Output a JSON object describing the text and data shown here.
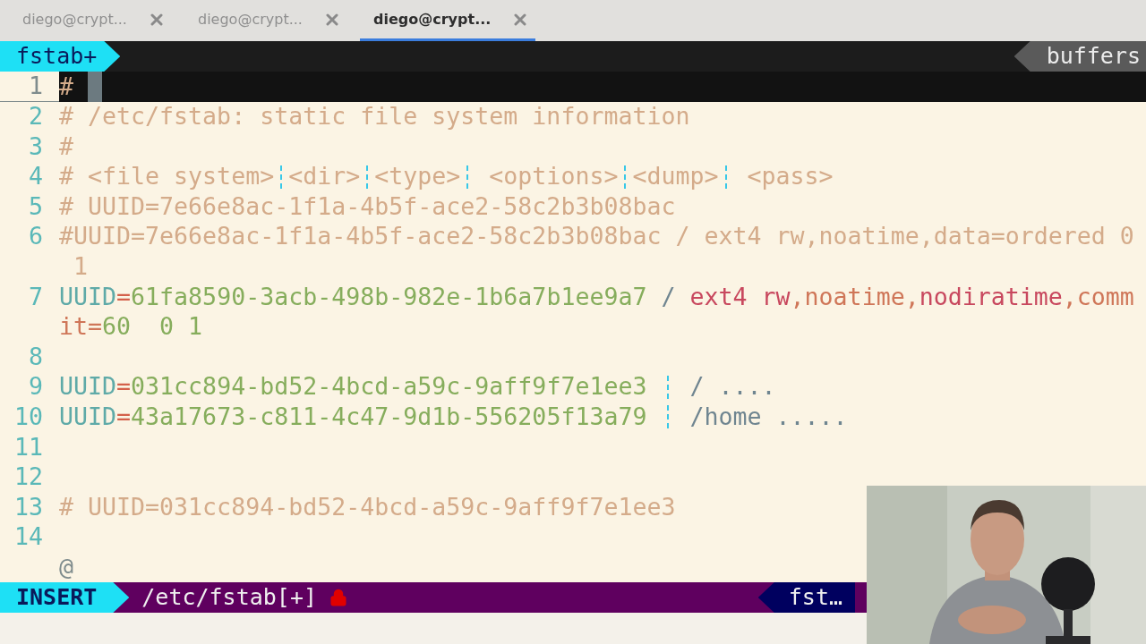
{
  "tabs": [
    {
      "label": "diego@crypt...",
      "selected": false
    },
    {
      "label": "diego@crypt...",
      "selected": false
    },
    {
      "label": "diego@crypt...",
      "selected": true
    }
  ],
  "tabline": {
    "buffer": "fstab+",
    "right": "buffers"
  },
  "lines": [
    {
      "number": "1",
      "current": true,
      "cursor": true,
      "rows": [
        [
          {
            "kind": "comment",
            "text": "#"
          }
        ]
      ]
    },
    {
      "number": "2",
      "current": false,
      "cursor": false,
      "rows": [
        [
          {
            "kind": "comment",
            "text": "# /etc/fstab: static file system information"
          }
        ]
      ]
    },
    {
      "number": "3",
      "current": false,
      "cursor": false,
      "rows": [
        [
          {
            "kind": "comment",
            "text": "#"
          }
        ]
      ]
    },
    {
      "number": "4",
      "current": false,
      "cursor": false,
      "rows": [
        [
          {
            "kind": "comment",
            "text": "# <file system>"
          },
          {
            "kind": "guide"
          },
          {
            "kind": "comment",
            "text": "<dir>"
          },
          {
            "kind": "guide"
          },
          {
            "kind": "comment",
            "text": "<type>"
          },
          {
            "kind": "guide"
          },
          {
            "kind": "comment",
            "text": " <options>"
          },
          {
            "kind": "guide"
          },
          {
            "kind": "comment",
            "text": "<dump>"
          },
          {
            "kind": "guide"
          },
          {
            "kind": "comment",
            "text": " <pass>"
          }
        ]
      ]
    },
    {
      "number": "5",
      "current": false,
      "cursor": false,
      "rows": [
        [
          {
            "kind": "comment",
            "text": "# UUID=7e66e8ac-1f1a-4b5f-ace2-58c2b3b08bac"
          }
        ]
      ]
    },
    {
      "number": "6",
      "current": false,
      "cursor": false,
      "rows": [
        [
          {
            "kind": "comment",
            "text": "#UUID=7e66e8ac-1f1a-4b5f-ace2-58c2b3b08bac / ext4 rw,noatime,data=ordered 0"
          }
        ],
        [
          {
            "kind": "comment",
            "text": " 1"
          }
        ]
      ]
    },
    {
      "number": "7",
      "current": false,
      "cursor": false,
      "rows": [
        [
          {
            "kind": "key",
            "text": "UUID"
          },
          {
            "kind": "eq",
            "text": "="
          },
          {
            "kind": "value",
            "text": "61fa8590-3acb-498b-982e-1b6a7b1ee9a7 "
          },
          {
            "kind": "slash",
            "text": "/ "
          },
          {
            "kind": "fs",
            "text": "ext4 rw"
          },
          {
            "kind": "opt",
            "text": ",noatime,"
          },
          {
            "kind": "fs",
            "text": "nodiratime"
          },
          {
            "kind": "opt",
            "text": ",comm"
          }
        ],
        [
          {
            "kind": "opt",
            "text": "it="
          },
          {
            "kind": "value",
            "text": "60  0 1"
          }
        ]
      ]
    },
    {
      "number": "8",
      "current": false,
      "cursor": false,
      "rows": [
        []
      ]
    },
    {
      "number": "9",
      "current": false,
      "cursor": false,
      "rows": [
        [
          {
            "kind": "key",
            "text": "UUID"
          },
          {
            "kind": "eq",
            "text": "="
          },
          {
            "kind": "value",
            "text": "031cc894-bd52-4bcd-a59c-9aff9f7e1ee3 "
          },
          {
            "kind": "guide"
          },
          {
            "kind": "slash",
            "text": " / ...."
          }
        ]
      ]
    },
    {
      "number": "10",
      "current": false,
      "cursor": false,
      "rows": [
        [
          {
            "kind": "key",
            "text": "UUID"
          },
          {
            "kind": "eq",
            "text": "="
          },
          {
            "kind": "value",
            "text": "43a17673-c811-4c47-9d1b-556205f13a79 "
          },
          {
            "kind": "guide"
          },
          {
            "kind": "slash",
            "text": " /home ....."
          }
        ]
      ]
    },
    {
      "number": "11",
      "current": false,
      "cursor": false,
      "rows": [
        []
      ]
    },
    {
      "number": "12",
      "current": false,
      "cursor": false,
      "rows": [
        []
      ]
    },
    {
      "number": "13",
      "current": false,
      "cursor": false,
      "rows": [
        [
          {
            "kind": "comment",
            "text": "# UUID=031cc894-bd52-4bcd-a59c-9aff9f7e1ee3"
          }
        ]
      ]
    },
    {
      "number": "14",
      "current": false,
      "cursor": false,
      "rows": [
        []
      ]
    }
  ],
  "overflow_marker": "@",
  "statusline": {
    "mode": "INSERT",
    "file": "/etc/fstab[+]",
    "readonly": true,
    "right": "fst…"
  }
}
